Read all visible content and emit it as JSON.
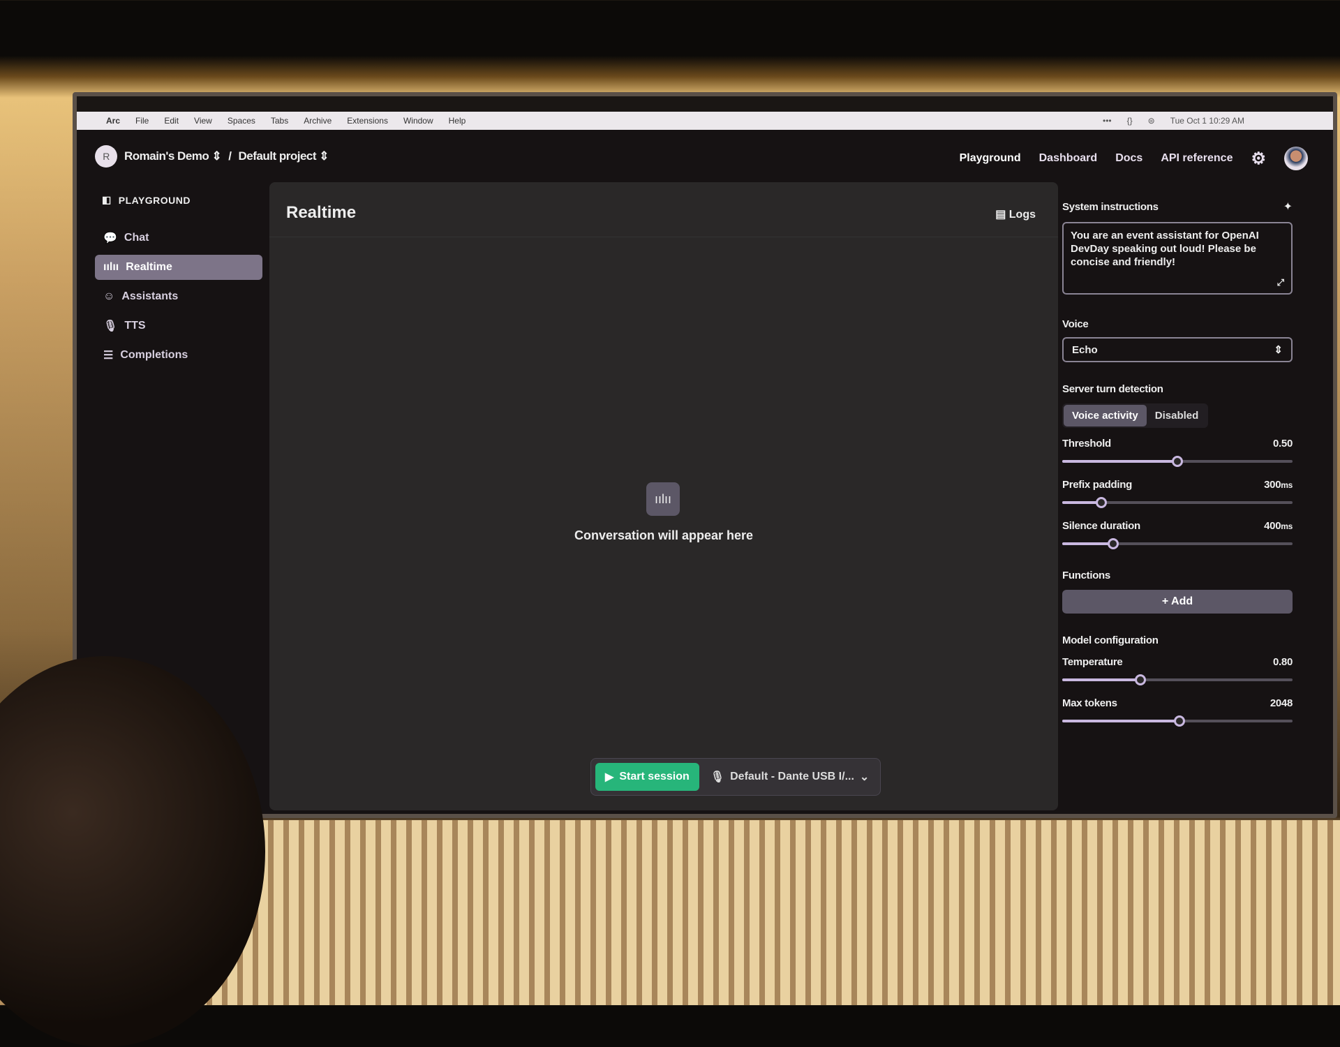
{
  "menubar": {
    "items": [
      "Arc",
      "File",
      "Edit",
      "View",
      "Spaces",
      "Tabs",
      "Archive",
      "Extensions",
      "Window",
      "Help"
    ],
    "status": [
      "•••",
      "{}",
      "⊜"
    ],
    "datetime": "Tue Oct 1  10:29 AM"
  },
  "header": {
    "org_initial": "R",
    "org": "Romain's Demo",
    "separator": "/",
    "project": "Default project",
    "nav": [
      "Playground",
      "Dashboard",
      "Docs",
      "API reference"
    ]
  },
  "sidebar": {
    "section": "PLAYGROUND",
    "items": [
      {
        "label": "Chat",
        "icon": "chat-icon"
      },
      {
        "label": "Realtime",
        "icon": "waveform-icon",
        "active": true
      },
      {
        "label": "Assistants",
        "icon": "robot-icon"
      },
      {
        "label": "TTS",
        "icon": "microphone-icon"
      },
      {
        "label": "Completions",
        "icon": "lines-icon"
      }
    ]
  },
  "main": {
    "title": "Realtime",
    "logs": "Logs",
    "empty": "Conversation will appear here",
    "start": "Start session",
    "device": "Default - Dante USB I/..."
  },
  "settings": {
    "system_label": "System instructions",
    "system_text": "You are an event assistant for OpenAI DevDay speaking out loud! Please be concise and friendly!",
    "voice_label": "Voice",
    "voice": "Echo",
    "turn_label": "Server turn detection",
    "turn_options": [
      "Voice activity",
      "Disabled"
    ],
    "turn_selected": "Voice activity",
    "sliders": [
      {
        "label": "Threshold",
        "value": "0.50",
        "unit": "",
        "level": 50
      },
      {
        "label": "Prefix padding",
        "value": "300",
        "unit": "ms",
        "level": 17
      },
      {
        "label": "Silence duration",
        "value": "400",
        "unit": "ms",
        "level": 22
      }
    ],
    "functions_label": "Functions",
    "add": "+ Add",
    "model_label": "Model configuration",
    "model_sliders": [
      {
        "label": "Temperature",
        "value": "0.80",
        "unit": "",
        "level": 34
      },
      {
        "label": "Max tokens",
        "value": "2048",
        "unit": "",
        "level": 51
      }
    ]
  },
  "colors": {
    "accent_green": "#27b57a",
    "active_item": "#7d7488",
    "slider": "#c9b8e0"
  }
}
